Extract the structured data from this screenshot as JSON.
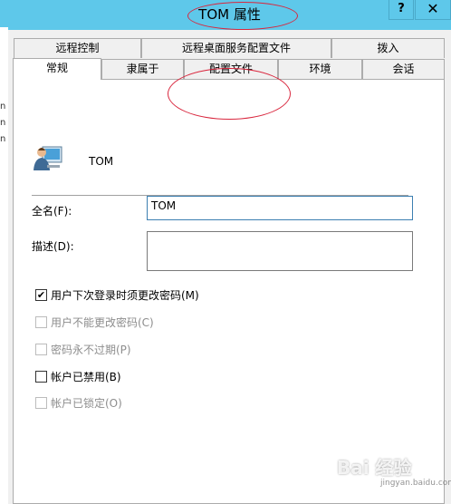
{
  "window": {
    "title": "TOM 属性",
    "help_label": "?",
    "close_label": "✕"
  },
  "tabs_row1": [
    {
      "label": "远程控制"
    },
    {
      "label": "远程桌面服务配置文件"
    },
    {
      "label": "拨入"
    }
  ],
  "tabs_row2": [
    {
      "label": "常规",
      "active": true
    },
    {
      "label": "隶属于"
    },
    {
      "label": "配置文件"
    },
    {
      "label": "环境"
    },
    {
      "label": "会话"
    }
  ],
  "general": {
    "user_name": "TOM",
    "fullname_label": "全名(F):",
    "fullname_value": "TOM",
    "description_label": "描述(D):",
    "description_value": ""
  },
  "checkboxes": [
    {
      "label": "用户下次登录时须更改密码(M)",
      "checked": true,
      "enabled": true
    },
    {
      "label": "用户不能更改密码(C)",
      "checked": false,
      "enabled": false
    },
    {
      "label": "密码永不过期(P)",
      "checked": false,
      "enabled": false
    },
    {
      "label": "帐户已禁用(B)",
      "checked": false,
      "enabled": true
    },
    {
      "label": "帐户已锁定(O)",
      "checked": false,
      "enabled": false
    }
  ],
  "background_fragments": {
    "f1": "n",
    "f2": "n",
    "f3": "n"
  },
  "watermark": {
    "text": "Bai 经验",
    "sub": "jingyan.baidu.com"
  },
  "colors": {
    "titlebar": "#5ec8ea",
    "annotation": "#d9273e"
  }
}
